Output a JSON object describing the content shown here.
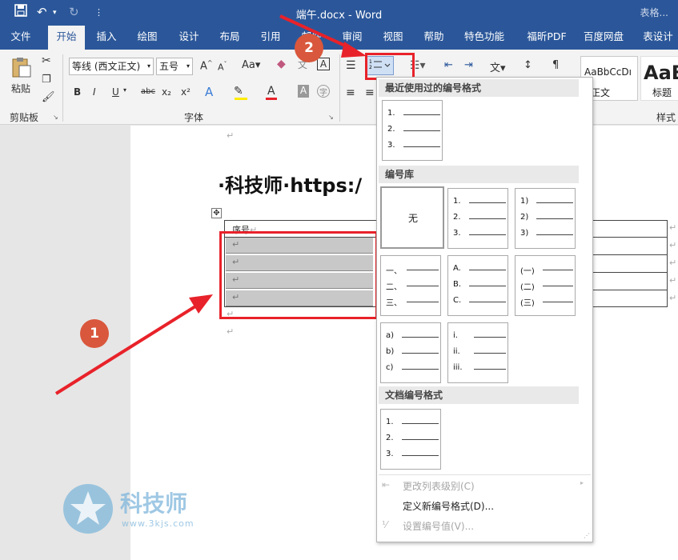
{
  "window": {
    "title": "端午.docx - Word",
    "right_tab": "表格..."
  },
  "quick_access": [
    "save-icon",
    "undo-icon",
    "redo-icon",
    "customize-icon"
  ],
  "tabs": [
    {
      "label": "文件"
    },
    {
      "label": "开始"
    },
    {
      "label": "插入"
    },
    {
      "label": "绘图"
    },
    {
      "label": "设计"
    },
    {
      "label": "布局"
    },
    {
      "label": "引用"
    },
    {
      "label": "邮件"
    },
    {
      "label": "审阅"
    },
    {
      "label": "视图"
    },
    {
      "label": "帮助"
    },
    {
      "label": "特色功能"
    },
    {
      "label": "福昕PDF"
    },
    {
      "label": "百度网盘"
    },
    {
      "label": "表设计"
    }
  ],
  "ribbon": {
    "clipboard": {
      "paste": "粘贴",
      "group": "剪贴板"
    },
    "font": {
      "font_name": "等线 (西文正文)",
      "font_size": "五号",
      "group": "字体",
      "buttons": [
        "B",
        "I",
        "U",
        "abc",
        "x₂",
        "x²",
        "A",
        "Aa",
        "A"
      ]
    },
    "styles": {
      "sample1": "AaBbCcDı",
      "name1": "正文",
      "sample2": "AaB",
      "name2": "标题",
      "group": "样式"
    }
  },
  "document": {
    "heading": "·科技师·https:/",
    "table_header": "序号",
    "row_count": 4
  },
  "badges": {
    "step1": "1",
    "step2": "2"
  },
  "numbering_menu": {
    "recent_title": "最近使用过的编号格式",
    "library_title": "编号库",
    "doc_title": "文档编号格式",
    "none_label": "无",
    "recent": [
      [
        "1.",
        "2.",
        "3."
      ]
    ],
    "library": [
      [
        "1.",
        "2.",
        "3."
      ],
      [
        "1)",
        "2)",
        "3)"
      ],
      [
        "一、",
        "二、",
        "三、"
      ],
      [
        "A.",
        "B.",
        "C."
      ],
      [
        "(一)",
        "(二)",
        "(三)"
      ],
      [
        "a)",
        "b)",
        "c)"
      ],
      [
        "i.",
        "ii.",
        "iii."
      ]
    ],
    "doc_formats": [
      [
        "1.",
        "2.",
        "3."
      ]
    ],
    "items": [
      {
        "label": "更改列表级别(C)",
        "enabled": false
      },
      {
        "label": "定义新编号格式(D)...",
        "enabled": true
      },
      {
        "label": "设置编号值(V)...",
        "enabled": false
      }
    ]
  },
  "watermark": {
    "name": "科技师",
    "url": "www.3kjs.com"
  },
  "colors": {
    "word_blue": "#2b579a",
    "highlight_red": "#e8222a",
    "badge": "#d9573c"
  }
}
